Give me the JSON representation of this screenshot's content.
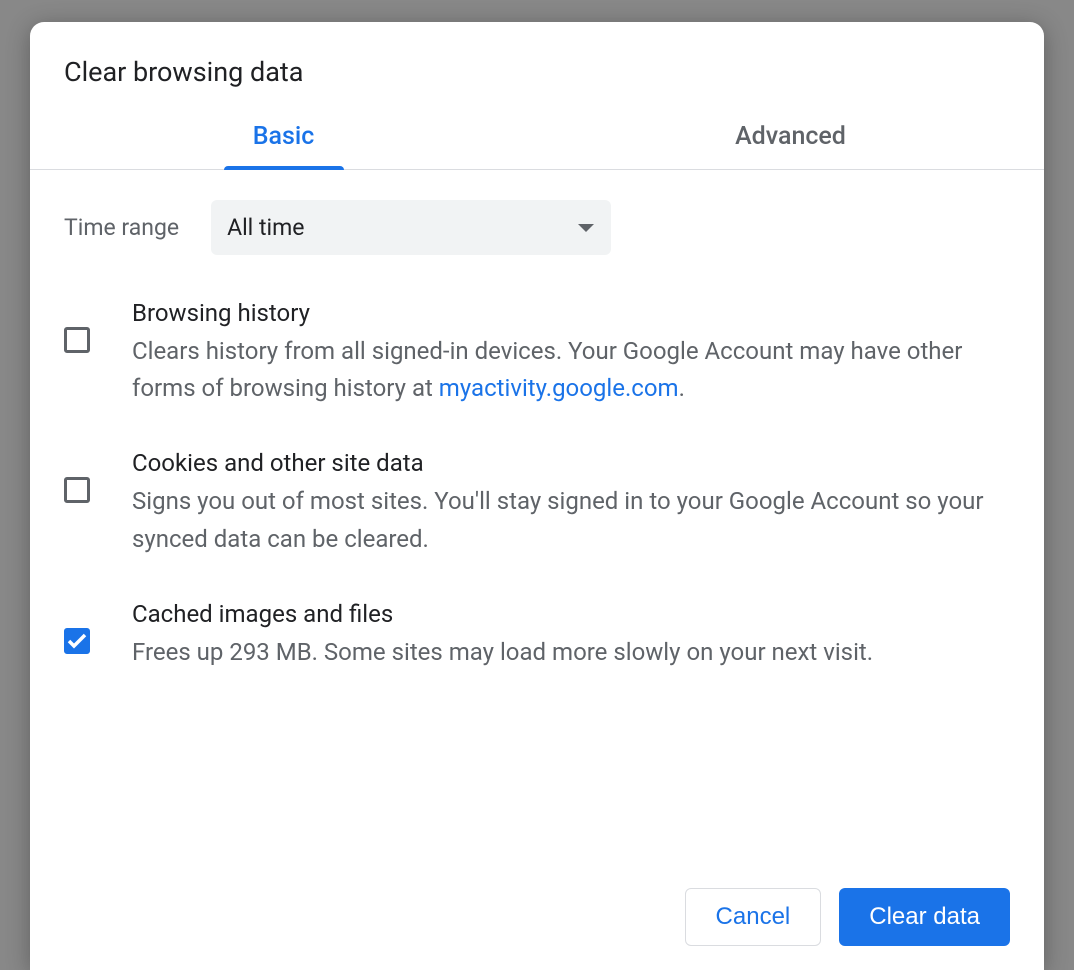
{
  "dialog": {
    "title": "Clear browsing data",
    "tabs": {
      "basic": "Basic",
      "advanced": "Advanced",
      "active": "basic"
    },
    "timeRange": {
      "label": "Time range",
      "value": "All time"
    },
    "options": [
      {
        "title": "Browsing history",
        "descBefore": "Clears history from all signed-in devices. Your Google Account may have other forms of browsing history at ",
        "link": "myactivity.google.com",
        "descAfter": ".",
        "checked": false
      },
      {
        "title": "Cookies and other site data",
        "descBefore": "Signs you out of most sites. You'll stay signed in to your Google Account so your synced data can be cleared.",
        "link": "",
        "descAfter": "",
        "checked": false
      },
      {
        "title": "Cached images and files",
        "descBefore": "Frees up 293 MB. Some sites may load more slowly on your next visit.",
        "link": "",
        "descAfter": "",
        "checked": true
      }
    ],
    "buttons": {
      "cancel": "Cancel",
      "clear": "Clear data"
    }
  }
}
